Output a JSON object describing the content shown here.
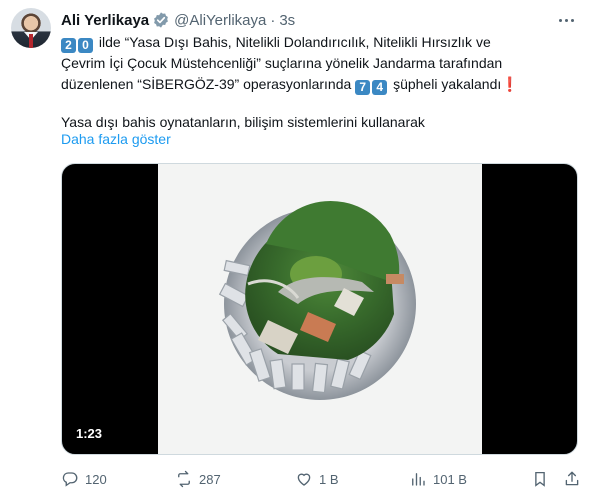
{
  "author": {
    "name": "Ali Yerlikaya",
    "handle": "@AliYerlikaya",
    "separator": "·",
    "time": "3s"
  },
  "tweet": {
    "line1_keycaps": [
      "2",
      "0"
    ],
    "line1_text": "ilde “Yasa Dışı Bahis, Nitelikli Dolandırıcılık, Nitelikli Hırsızlık ve",
    "line2": "Çevrim İçi Çocuk Müstehcenliği” suçlarına yönelik Jandarma tarafından",
    "line3_text": "düzenlenen “SİBERGÖZ-39” operasyonlarında",
    "line3_keycaps": [
      "7",
      "4"
    ],
    "line3_tail": "şüpheli yakalandı",
    "line3_excl": "❗",
    "line4": "Yasa dışı bahis oynatanların, bilişim sistemlerini kullanarak",
    "show_more": "Daha fazla göster"
  },
  "video": {
    "duration": "1:23"
  },
  "actions": {
    "replies": "120",
    "reposts": "287",
    "likes": "1 B",
    "views": "101 B"
  },
  "colors": {
    "link": "#1d9bf0",
    "muted": "#536471",
    "keycap": "#3b88c3"
  }
}
